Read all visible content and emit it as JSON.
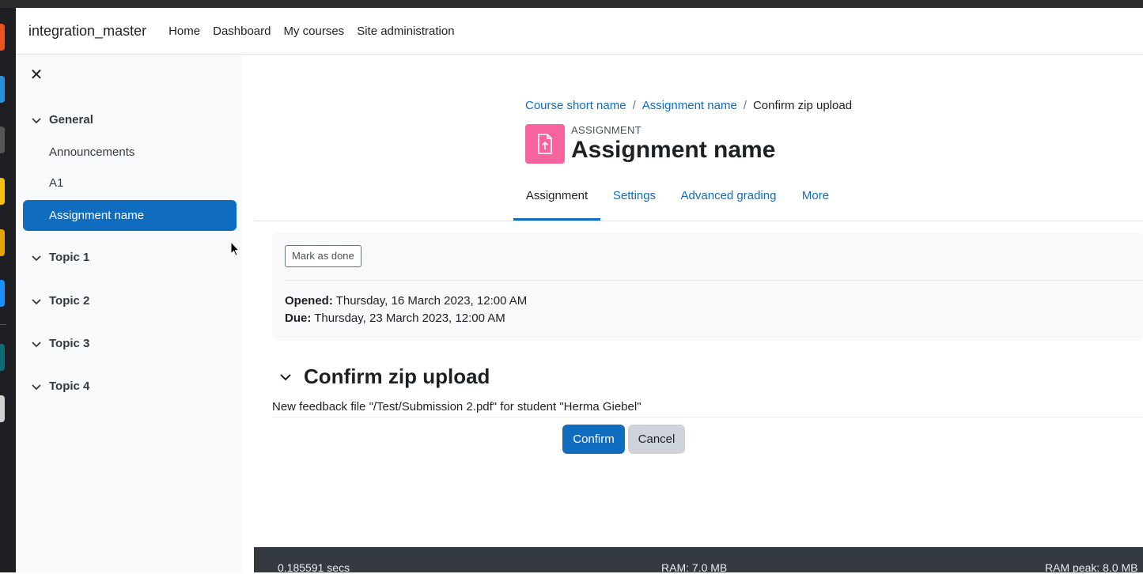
{
  "navbar": {
    "site_name": "integration_master",
    "links": [
      "Home",
      "Dashboard",
      "My courses",
      "Site administration"
    ]
  },
  "drawer": {
    "close_icon": "close-icon",
    "sections": [
      {
        "label": "General",
        "items": [
          "Announcements",
          "A1",
          "Assignment name"
        ]
      },
      {
        "label": "Topic 1"
      },
      {
        "label": "Topic 2"
      },
      {
        "label": "Topic 3"
      },
      {
        "label": "Topic 4"
      }
    ],
    "active_item": "Assignment name"
  },
  "breadcrumb": {
    "course": "Course short name",
    "sep1": "/",
    "assignment": "Assignment name",
    "sep2": "/",
    "current": "Confirm zip upload"
  },
  "activity": {
    "type_label": "ASSIGNMENT",
    "title": "Assignment name",
    "icon": "assignment-upload-icon",
    "icon_color": "#f7639c"
  },
  "tabs": [
    "Assignment",
    "Settings",
    "Advanced grading",
    "More"
  ],
  "info": {
    "mark_done_label": "Mark as done",
    "opened_label": "Opened:",
    "opened_value": " Thursday, 16 March 2023, 12:00 AM",
    "due_label": "Due:",
    "due_value": " Thursday, 23 March 2023, 12:00 AM"
  },
  "confirm": {
    "heading": "Confirm zip upload",
    "message": "New feedback file \"/Test/Submission 2.pdf\" for student \"Herma Giebel\"",
    "confirm_label": "Confirm",
    "cancel_label": "Cancel"
  },
  "footer": {
    "time": "0.185591 secs",
    "ram": "RAM: 7.0 MB",
    "ram_peak": "RAM peak: 8.0 MB"
  },
  "colors": {
    "primary": "#0f6cbf",
    "drawer_bg": "#f8f9fa",
    "footer_bg": "#343a40"
  }
}
